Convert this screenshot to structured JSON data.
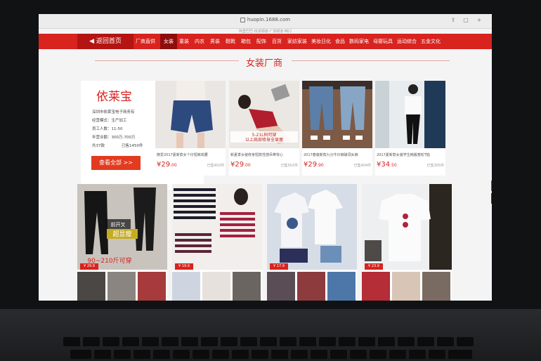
{
  "browser": {
    "url": "huopin.1688.com",
    "subinfo": "阿里巴巴·找货频道·厂货频道·档口"
  },
  "nav": {
    "back_label": "返回首页",
    "items": [
      "厂商直供",
      "女装",
      "童装",
      "内衣",
      "男装",
      "鞋靴",
      "箱包",
      "配饰",
      "百货",
      "家纺家装",
      "美妆日化",
      "食品",
      "数码家电",
      "母婴玩具",
      "运动综合",
      "五金文化"
    ],
    "active_index": 1,
    "color": "#d8231f"
  },
  "section": {
    "title": "女装厂商"
  },
  "brand": {
    "name": "依莱宝",
    "info": [
      "深圳市依莱宝电子商务有",
      "经营模式：生产加工",
      "员工人数：11-50",
      "年营业额：300万-700万",
      "共37款",
      "已售1450件"
    ],
    "button_label": "查看全部 >>"
  },
  "products": [
    {
      "desc": "微爱2017夏新款女个仔短裤高腰",
      "price": "29",
      "cents": ".00",
      "sold": "已售402件"
    },
    {
      "desc": "新夏季女装修身短款性感吊带背心",
      "price": "29",
      "cents": ".00",
      "sold": "已售502件"
    },
    {
      "desc": "2017春装新款九分牛仔裤破洞女裤",
      "price": "29",
      "cents": ".90",
      "sold": "已售404件"
    },
    {
      "desc": "2017夏新款女装学生韩版宽松T恤",
      "price": "34",
      "cents": ".50",
      "sold": "已售305件"
    }
  ],
  "tiles": [
    {
      "tag": "¥ 29.9",
      "overlay_text": "超显瘦",
      "bottom_text": "90~210斤可穿",
      "side_text": "前开叉"
    },
    {
      "tag": "¥ 19.9"
    },
    {
      "tag": "¥ 17.9"
    },
    {
      "tag": "¥ 23.9"
    }
  ],
  "product_overlay_text": [
    "5-21L码可穿",
    "以上肩部修身全显瘦"
  ],
  "side_tools": [
    "back-to-top-icon",
    "clipboard-icon"
  ]
}
